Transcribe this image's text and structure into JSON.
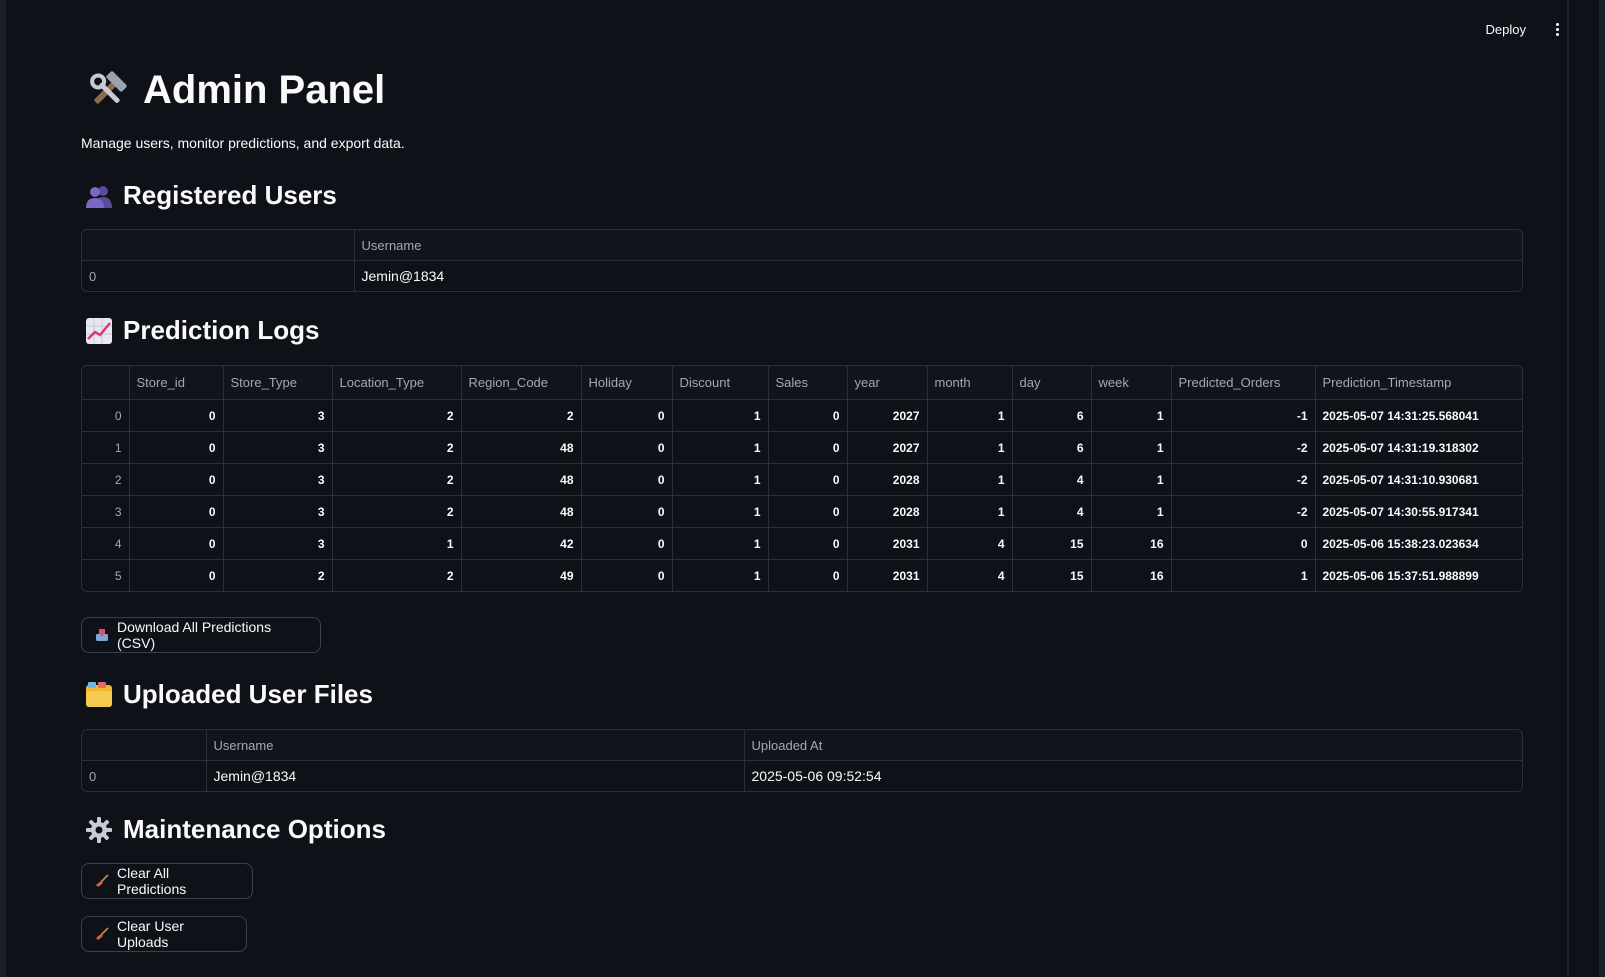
{
  "topbar": {
    "deploy_label": "Deploy"
  },
  "header": {
    "title": "Admin Panel",
    "subtitle": "Manage users, monitor predictions, and export data."
  },
  "registered_users": {
    "heading": "Registered Users",
    "columns": [
      "",
      "Username"
    ],
    "rows": [
      {
        "index": "0",
        "username": "Jemin@1834"
      }
    ]
  },
  "prediction_logs": {
    "heading": "Prediction Logs",
    "columns": [
      "",
      "Store_id",
      "Store_Type",
      "Location_Type",
      "Region_Code",
      "Holiday",
      "Discount",
      "Sales",
      "year",
      "month",
      "day",
      "week",
      "Predicted_Orders",
      "Prediction_Timestamp"
    ],
    "rows": [
      [
        "0",
        "0",
        "3",
        "2",
        "2",
        "0",
        "1",
        "0",
        "2027",
        "1",
        "6",
        "1",
        "-1",
        "2025-05-07 14:31:25.568041"
      ],
      [
        "1",
        "0",
        "3",
        "2",
        "48",
        "0",
        "1",
        "0",
        "2027",
        "1",
        "6",
        "1",
        "-2",
        "2025-05-07 14:31:19.318302"
      ],
      [
        "2",
        "0",
        "3",
        "2",
        "48",
        "0",
        "1",
        "0",
        "2028",
        "1",
        "4",
        "1",
        "-2",
        "2025-05-07 14:31:10.930681"
      ],
      [
        "3",
        "0",
        "3",
        "2",
        "48",
        "0",
        "1",
        "0",
        "2028",
        "1",
        "4",
        "1",
        "-2",
        "2025-05-07 14:30:55.917341"
      ],
      [
        "4",
        "0",
        "3",
        "1",
        "42",
        "0",
        "1",
        "0",
        "2031",
        "4",
        "15",
        "16",
        "0",
        "2025-05-06 15:38:23.023634"
      ],
      [
        "5",
        "0",
        "2",
        "2",
        "49",
        "0",
        "1",
        "0",
        "2031",
        "4",
        "15",
        "16",
        "1",
        "2025-05-06 15:37:51.988899"
      ]
    ]
  },
  "download_button": {
    "label": "Download All Predictions (CSV)",
    "icon": "inbox-tray-icon"
  },
  "uploaded_files": {
    "heading": "Uploaded User Files",
    "columns": [
      "",
      "Username",
      "Uploaded At"
    ],
    "rows": [
      {
        "index": "0",
        "username": "Jemin@1834",
        "uploaded_at": "2025-05-06 09:52:54"
      }
    ]
  },
  "maintenance": {
    "heading": "Maintenance Options",
    "clear_predictions_label": "Clear All Predictions",
    "clear_uploads_label": "Clear User Uploads",
    "icon": "broom-icon"
  },
  "colors": {
    "background": "#0e1117",
    "text": "#fafafa",
    "muted": "#a3a8b4",
    "border": "#2b2f38"
  }
}
